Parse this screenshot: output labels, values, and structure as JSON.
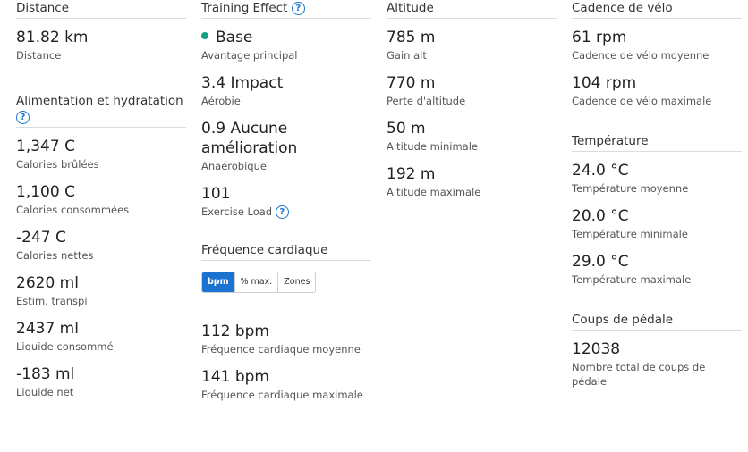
{
  "distance": {
    "title": "Distance",
    "value": "81.82 km",
    "label": "Distance"
  },
  "nutrition": {
    "title": "Alimentation et hydratation",
    "items": [
      {
        "value": "1,347 C",
        "label": "Calories brûlées"
      },
      {
        "value": "1,100 C",
        "label": "Calories consommées"
      },
      {
        "value": "-247 C",
        "label": "Calories nettes"
      },
      {
        "value": "2620 ml",
        "label": "Estim. transpi"
      },
      {
        "value": "2437 ml",
        "label": "Liquide consommé"
      },
      {
        "value": "-183 ml",
        "label": "Liquide net"
      }
    ]
  },
  "training_effect": {
    "title": "Training Effect",
    "primary": {
      "value": "Base",
      "label": "Avantage principal",
      "dot_color": "#16a085"
    },
    "aerobic": {
      "value": "3.4 Impact",
      "label": "Aérobie"
    },
    "anaerobic": {
      "value": "0.9 Aucune amélioration",
      "label": "Anaérobique"
    },
    "load": {
      "value": "101",
      "label": "Exercise Load"
    }
  },
  "heart_rate": {
    "title": "Fréquence cardiaque",
    "toggle": [
      "bpm",
      "% max.",
      "Zones"
    ],
    "items": [
      {
        "value": "112 bpm",
        "label": "Fréquence cardiaque moyenne"
      },
      {
        "value": "141 bpm",
        "label": "Fréquence cardiaque maximale"
      }
    ]
  },
  "altitude": {
    "title": "Altitude",
    "items": [
      {
        "value": "785 m",
        "label": "Gain alt"
      },
      {
        "value": "770 m",
        "label": "Perte d'altitude"
      },
      {
        "value": "50 m",
        "label": "Altitude minimale"
      },
      {
        "value": "192 m",
        "label": "Altitude maximale"
      }
    ]
  },
  "cadence": {
    "title": "Cadence de vélo",
    "items": [
      {
        "value": "61 rpm",
        "label": "Cadence de vélo moyenne"
      },
      {
        "value": "104 rpm",
        "label": "Cadence de vélo maximale"
      }
    ]
  },
  "temperature": {
    "title": "Température",
    "items": [
      {
        "value": "24.0 °C",
        "label": "Température moyenne"
      },
      {
        "value": "20.0 °C",
        "label": "Température minimale"
      },
      {
        "value": "29.0 °C",
        "label": "Température maximale"
      }
    ]
  },
  "strokes": {
    "title": "Coups de pédale",
    "value": "12038",
    "label": "Nombre total de coups de pédale"
  },
  "colors": {
    "accent": "#1a73d0",
    "base_dot": "#16a085"
  },
  "icons": {
    "help": "?"
  }
}
